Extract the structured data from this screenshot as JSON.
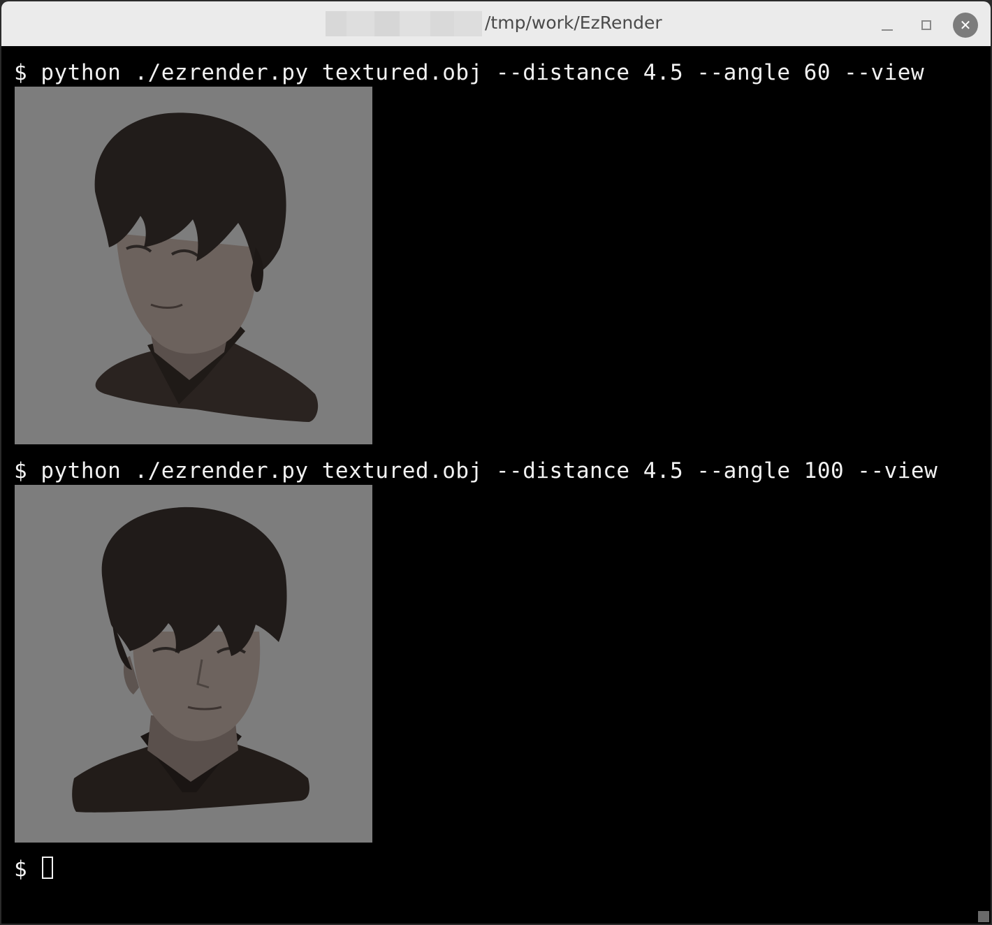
{
  "window": {
    "title": "/tmp/work/EzRender",
    "minimize_icon": "minimize-icon",
    "maximize_icon": "maximize-icon",
    "close_icon": "close-icon",
    "close_glyph": "✕"
  },
  "terminal": {
    "commands": [
      {
        "prompt": "$",
        "text": "$ python ./ezrender.py textured.obj --distance 4.5 --angle 60 --view",
        "output_image": "render-view-angle-60"
      },
      {
        "prompt": "$",
        "text": "$ python ./ezrender.py textured.obj --distance 4.5 --angle 100 --view",
        "output_image": "render-view-angle-100"
      }
    ],
    "current_prompt": "$"
  },
  "colors": {
    "terminal_bg": "#000000",
    "terminal_fg": "#f2f2f2",
    "render_bg": "#7d7d7d",
    "titlebar_bg": "#ebebeb"
  }
}
